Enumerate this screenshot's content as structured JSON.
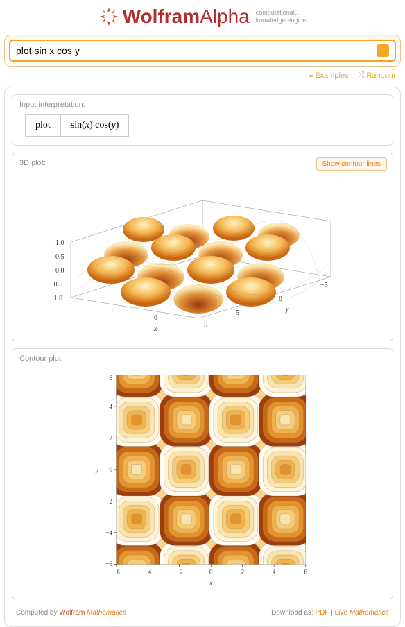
{
  "header": {
    "brand_prefix": "Wolfram",
    "brand_suffix": "Alpha",
    "tagline_line1": "computational..",
    "tagline_line2": "knowledge engine"
  },
  "search": {
    "query": "plot sin x cos y"
  },
  "sub_links": {
    "examples": "Examples",
    "random": "Random"
  },
  "pods": {
    "interpretation": {
      "title": "Input interpretation:",
      "cells": [
        "plot",
        "sin(x) cos(y)"
      ]
    },
    "plot3d": {
      "title": "3D plot:",
      "action": "Show contour lines"
    },
    "contour": {
      "title": "Contour plot:"
    }
  },
  "footer": {
    "computed_by_prefix": "Computed by ",
    "computed_by_link": "Wolfram Mathematica",
    "download_prefix": "Download as: ",
    "pdf": "PDF",
    "live": "Live Mathematica"
  },
  "chart_data": [
    {
      "type": "surface",
      "title": "3D plot",
      "function": "sin(x)*cos(y)",
      "xlabel": "x",
      "ylabel": "y",
      "zlabel": "",
      "xrange": [
        -6,
        6
      ],
      "yrange": [
        -6,
        6
      ],
      "zrange": [
        -1.0,
        1.0
      ],
      "xticks": [
        -5,
        0,
        5
      ],
      "yticks": [
        -5,
        0,
        5
      ],
      "zticks": [
        -1.0,
        -0.5,
        0.0,
        0.5,
        1.0
      ],
      "description": "3D surface of sin(x)cos(y) showing periodic peaks (z≈1) and troughs (z≈-1) in a checkerboard-like pattern"
    },
    {
      "type": "contour",
      "title": "Contour plot",
      "function": "sin(x)*cos(y)",
      "xlabel": "x",
      "ylabel": "y",
      "xrange": [
        -6,
        6
      ],
      "yrange": [
        -6,
        6
      ],
      "xticks": [
        -6,
        -4,
        -2,
        0,
        2,
        4,
        6
      ],
      "yticks": [
        -6,
        -4,
        -2,
        0,
        2,
        4,
        6
      ],
      "levels": [
        -1.0,
        -0.75,
        -0.5,
        -0.25,
        0,
        0.25,
        0.5,
        0.75,
        1.0
      ],
      "colormap": "orange-white-brown",
      "description": "Filled contour of sin(x)cos(y); concentric rounded-square rings around extrema at (x,y) where sin(x)=±1 and cos(y)=±1"
    }
  ]
}
